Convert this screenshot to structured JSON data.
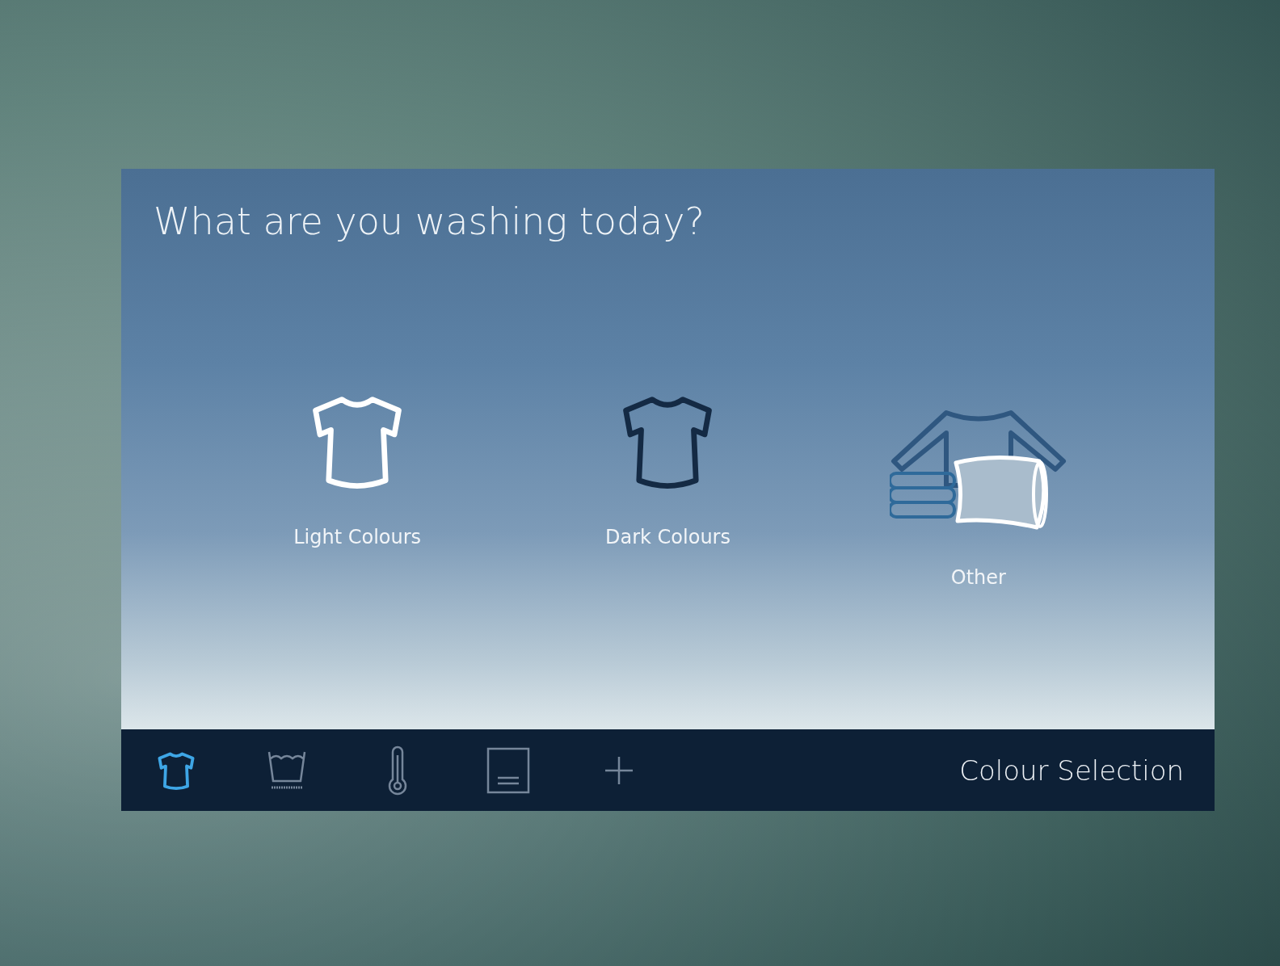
{
  "screen": {
    "title": "What are you washing today?"
  },
  "options": [
    {
      "kind": "light",
      "label": "Light Colours"
    },
    {
      "kind": "dark",
      "label": "Dark Colours"
    },
    {
      "kind": "other",
      "label": "Other"
    }
  ],
  "nav_bar": {
    "steps": [
      {
        "kind": "shirt",
        "selected": true
      },
      {
        "kind": "basin",
        "selected": false
      },
      {
        "kind": "thermometer",
        "selected": false
      },
      {
        "kind": "panel",
        "selected": false
      },
      {
        "kind": "plus",
        "selected": false
      }
    ],
    "current_step": "Colour Selection"
  }
}
